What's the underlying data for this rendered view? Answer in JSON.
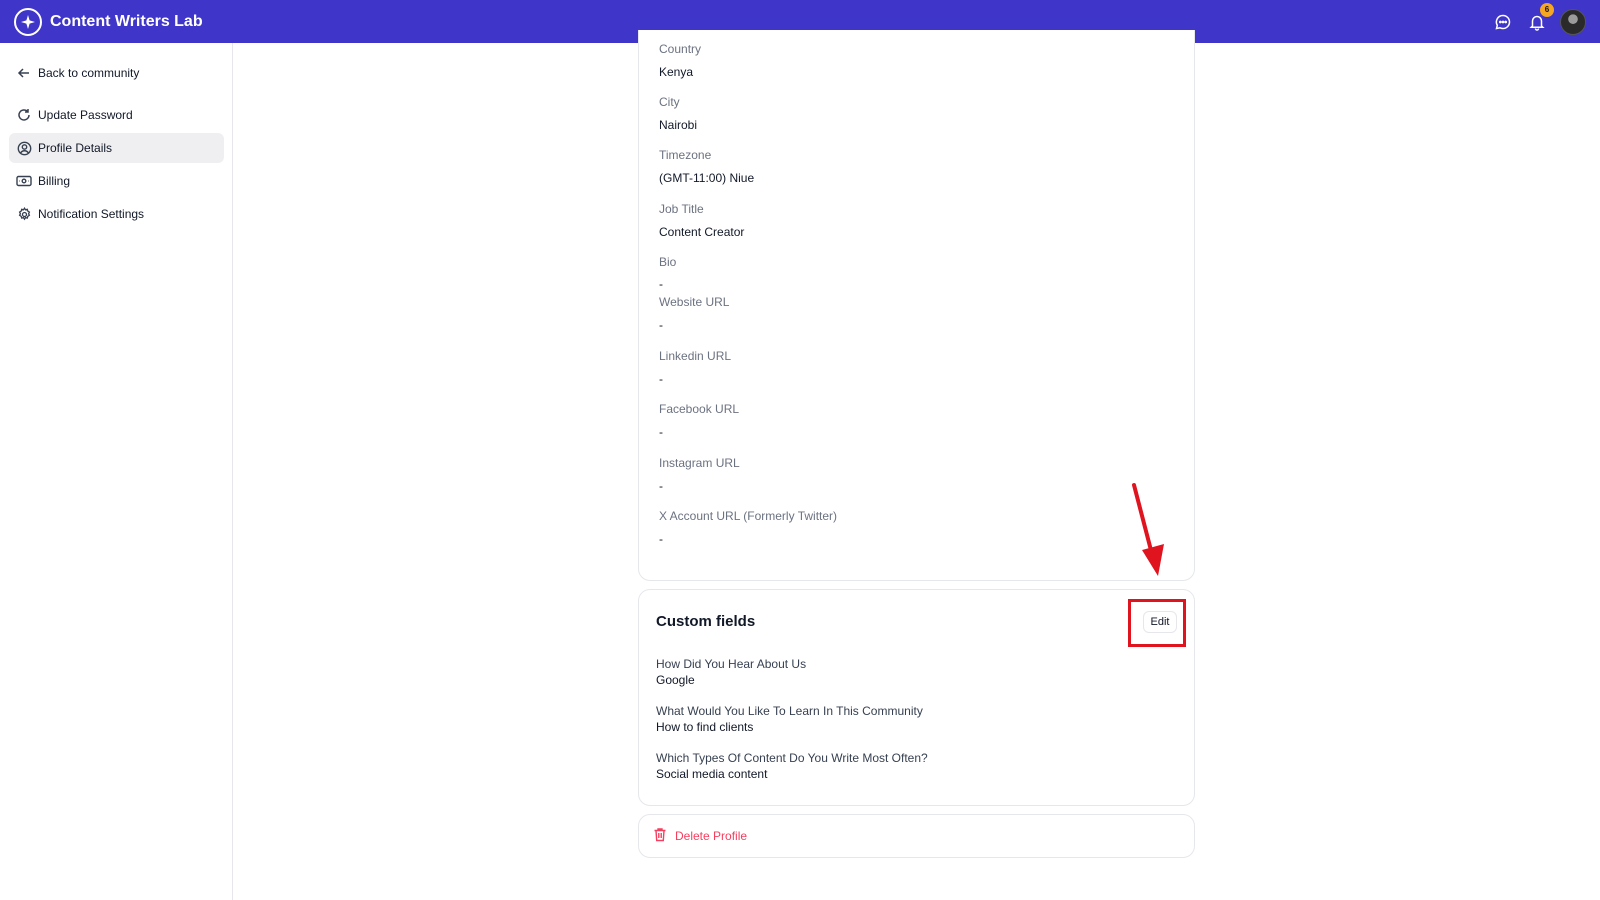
{
  "app": {
    "title": "Content Writers Lab"
  },
  "topbar": {
    "notification_count": "6"
  },
  "sidebar": {
    "back_label": "Back to community",
    "items": [
      {
        "label": "Update Password",
        "icon": "refresh-icon"
      },
      {
        "label": "Profile Details",
        "icon": "user-circle-icon",
        "active": true
      },
      {
        "label": "Billing",
        "icon": "billing-icon"
      },
      {
        "label": "Notification Settings",
        "icon": "gear-icon"
      }
    ]
  },
  "profile": {
    "fields": [
      {
        "label": "Country",
        "value": "Kenya"
      },
      {
        "label": "City",
        "value": "Nairobi"
      },
      {
        "label": "Timezone",
        "value": "(GMT-11:00) Niue"
      },
      {
        "label": "Job Title",
        "value": "Content Creator"
      },
      {
        "label": "Bio",
        "value": "-"
      },
      {
        "label": "Website URL",
        "value": "-"
      },
      {
        "label": "Linkedin URL",
        "value": "-"
      },
      {
        "label": "Facebook URL",
        "value": "-"
      },
      {
        "label": "Instagram URL",
        "value": "-"
      },
      {
        "label": "X Account URL (Formerly Twitter)",
        "value": "-"
      }
    ]
  },
  "custom_fields": {
    "title": "Custom fields",
    "edit_label": "Edit",
    "items": [
      {
        "question": "How Did You Hear About Us",
        "answer": "Google"
      },
      {
        "question": "What Would You Like To Learn In This Community",
        "answer": "How to find clients"
      },
      {
        "question": "Which Types Of Content Do You Write Most Often?",
        "answer": "Social media content"
      }
    ]
  },
  "delete": {
    "label": "Delete Profile"
  },
  "colors": {
    "brand": "#3f35c8",
    "danger": "#f43f5e",
    "annotation": "#e0141e"
  }
}
